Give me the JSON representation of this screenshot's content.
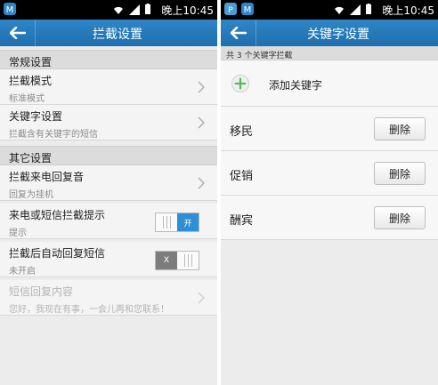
{
  "status": {
    "time": "晚上10:45"
  },
  "left": {
    "title": "拦截设置",
    "sections": [
      {
        "header": "常规设置"
      },
      {
        "header": "其它设置"
      }
    ],
    "rows": [
      {
        "title": "拦截模式",
        "sub": "标准模式"
      },
      {
        "title": "关键字设置",
        "sub": "拦截含有关键字的短信"
      },
      {
        "title": "拦截来电回复音",
        "sub": "回复为挂机"
      },
      {
        "title": "来电或短信拦截提示",
        "sub": "提示",
        "toggle": "开"
      },
      {
        "title": "拦截后自动回复短信",
        "sub": "未开启",
        "toggle": "X"
      },
      {
        "title": "短信回复内容",
        "sub": "您好，我现在有事，一会儿再和您联系！"
      }
    ]
  },
  "right": {
    "title": "关键字设置",
    "count_text": "共 3 个关键字拦截",
    "add_label": "添加关键字",
    "keywords": [
      {
        "text": "移民",
        "button": "删除"
      },
      {
        "text": "促销",
        "button": "删除"
      },
      {
        "text": "酬宾",
        "button": "删除"
      }
    ]
  },
  "colors": {
    "accent": "#2d8fd8",
    "appbar": "#1f6fae",
    "add_icon": "#5cb85c"
  }
}
